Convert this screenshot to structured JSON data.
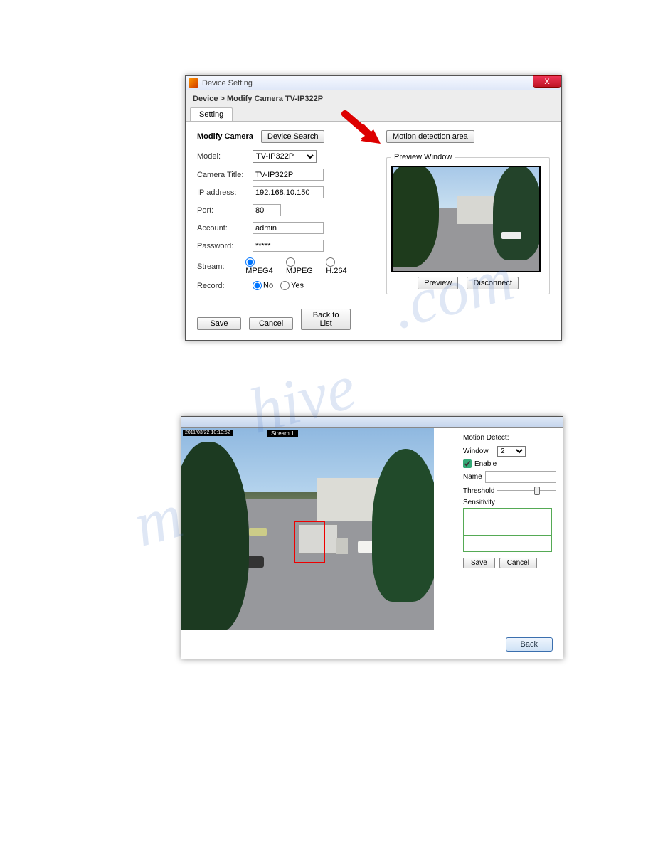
{
  "watermark": ".com",
  "watermark2": "hive",
  "watermark3": "m",
  "window1": {
    "titlebar": "Device Setting",
    "close": "X",
    "breadcrumb": "Device > Modify Camera TV-IP322P",
    "tab": "Setting",
    "section_title": "Modify Camera",
    "device_search": "Device Search",
    "labels": {
      "model": "Model:",
      "camera_title": "Camera Title:",
      "ip": "IP address:",
      "port": "Port:",
      "account": "Account:",
      "password": "Password:",
      "stream": "Stream:",
      "record": "Record:"
    },
    "values": {
      "model": "TV-IP322P",
      "camera_title": "TV-IP322P",
      "ip": "192.168.10.150",
      "port": "80",
      "account": "admin",
      "password": "*****"
    },
    "stream_opts": {
      "mpeg4": "MPEG4",
      "mjpeg": "MJPEG",
      "h264": "H.264"
    },
    "record_opts": {
      "no": "No",
      "yes": "Yes"
    },
    "motion_btn": "Motion detection area",
    "preview_legend": "Preview Window",
    "preview_btn": "Preview",
    "disconnect_btn": "Disconnect",
    "save": "Save",
    "cancel": "Cancel",
    "back_to_list": "Back to List"
  },
  "window2": {
    "timestamp": "2011/03/22 10:10:52",
    "stream_label": "Stream 1",
    "md_title": "Motion Detect:",
    "labels": {
      "window": "Window",
      "enable": "Enable",
      "name": "Name",
      "threshold": "Threshold",
      "sensitivity": "Sensitivity"
    },
    "window_value": "2",
    "enable_checked": true,
    "name_value": "",
    "save": "Save",
    "cancel": "Cancel",
    "back": "Back"
  }
}
